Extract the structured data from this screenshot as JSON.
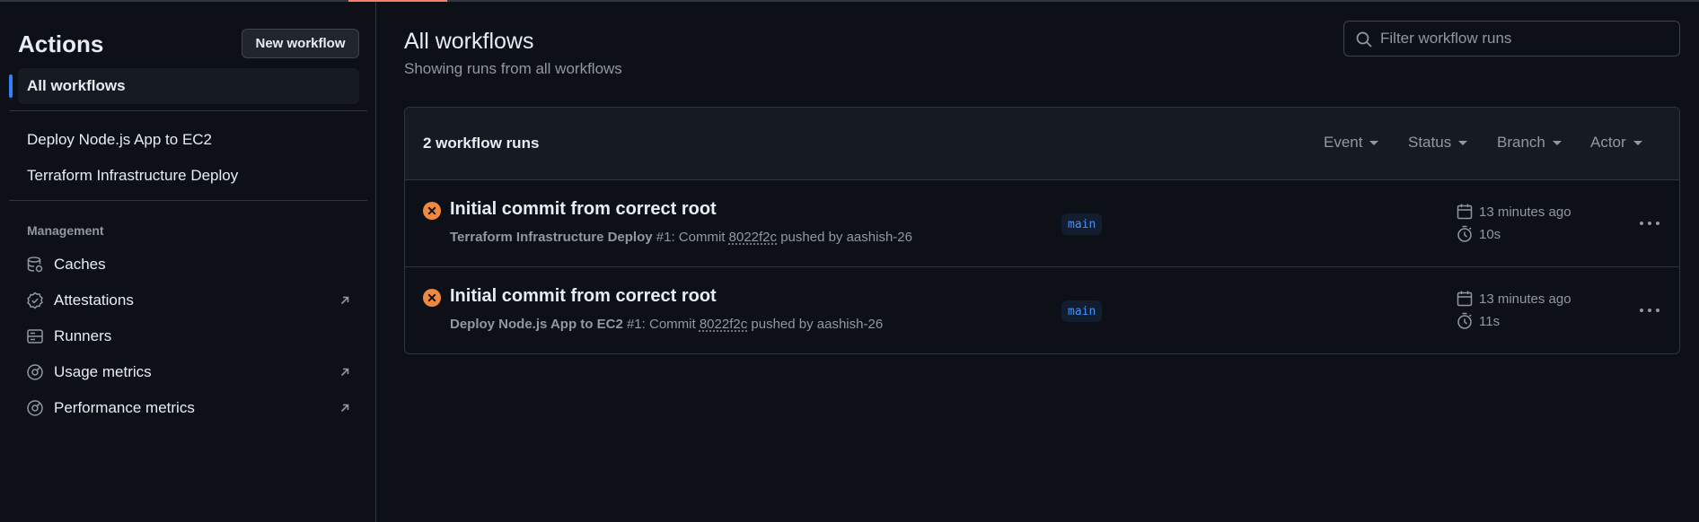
{
  "sidebar": {
    "title": "Actions",
    "new_workflow_label": "New workflow",
    "all_workflows_label": "All workflows",
    "workflows": [
      {
        "label": "Deploy Node.js App to EC2"
      },
      {
        "label": "Terraform Infrastructure Deploy"
      }
    ],
    "management": {
      "section_label": "Management",
      "items": [
        {
          "label": "Caches",
          "icon": "database-icon"
        },
        {
          "label": "Attestations",
          "icon": "verified-icon"
        },
        {
          "label": "Runners",
          "icon": "server-icon"
        },
        {
          "label": "Usage metrics",
          "icon": "meter-icon"
        },
        {
          "label": "Performance metrics",
          "icon": "meter-icon"
        }
      ]
    }
  },
  "main": {
    "title": "All workflows",
    "subtitle": "Showing runs from all workflows",
    "filter_placeholder": "Filter workflow runs",
    "runs_count": "2 workflow runs",
    "filters": [
      "Event",
      "Status",
      "Branch",
      "Actor"
    ],
    "runs": [
      {
        "title": "Initial commit from correct root",
        "workflow": "Terraform Infrastructure Deploy",
        "run_number": "#1",
        "commit_prefix": ": Commit ",
        "sha": "8022f2c",
        "pushed_by": " pushed by aashish-26",
        "branch": "main",
        "time_ago": "13 minutes ago",
        "duration": "10s",
        "status": "failure"
      },
      {
        "title": "Initial commit from correct root",
        "workflow": "Deploy Node.js App to EC2",
        "run_number": "#1",
        "commit_prefix": ": Commit ",
        "sha": "8022f2c",
        "pushed_by": " pushed by aashish-26",
        "branch": "main",
        "time_ago": "13 minutes ago",
        "duration": "11s",
        "status": "failure"
      }
    ]
  },
  "colors": {
    "background": "#0d1117",
    "accent": "#2f81f7",
    "failure": "#f0883e",
    "branch_text": "#4493f8"
  }
}
